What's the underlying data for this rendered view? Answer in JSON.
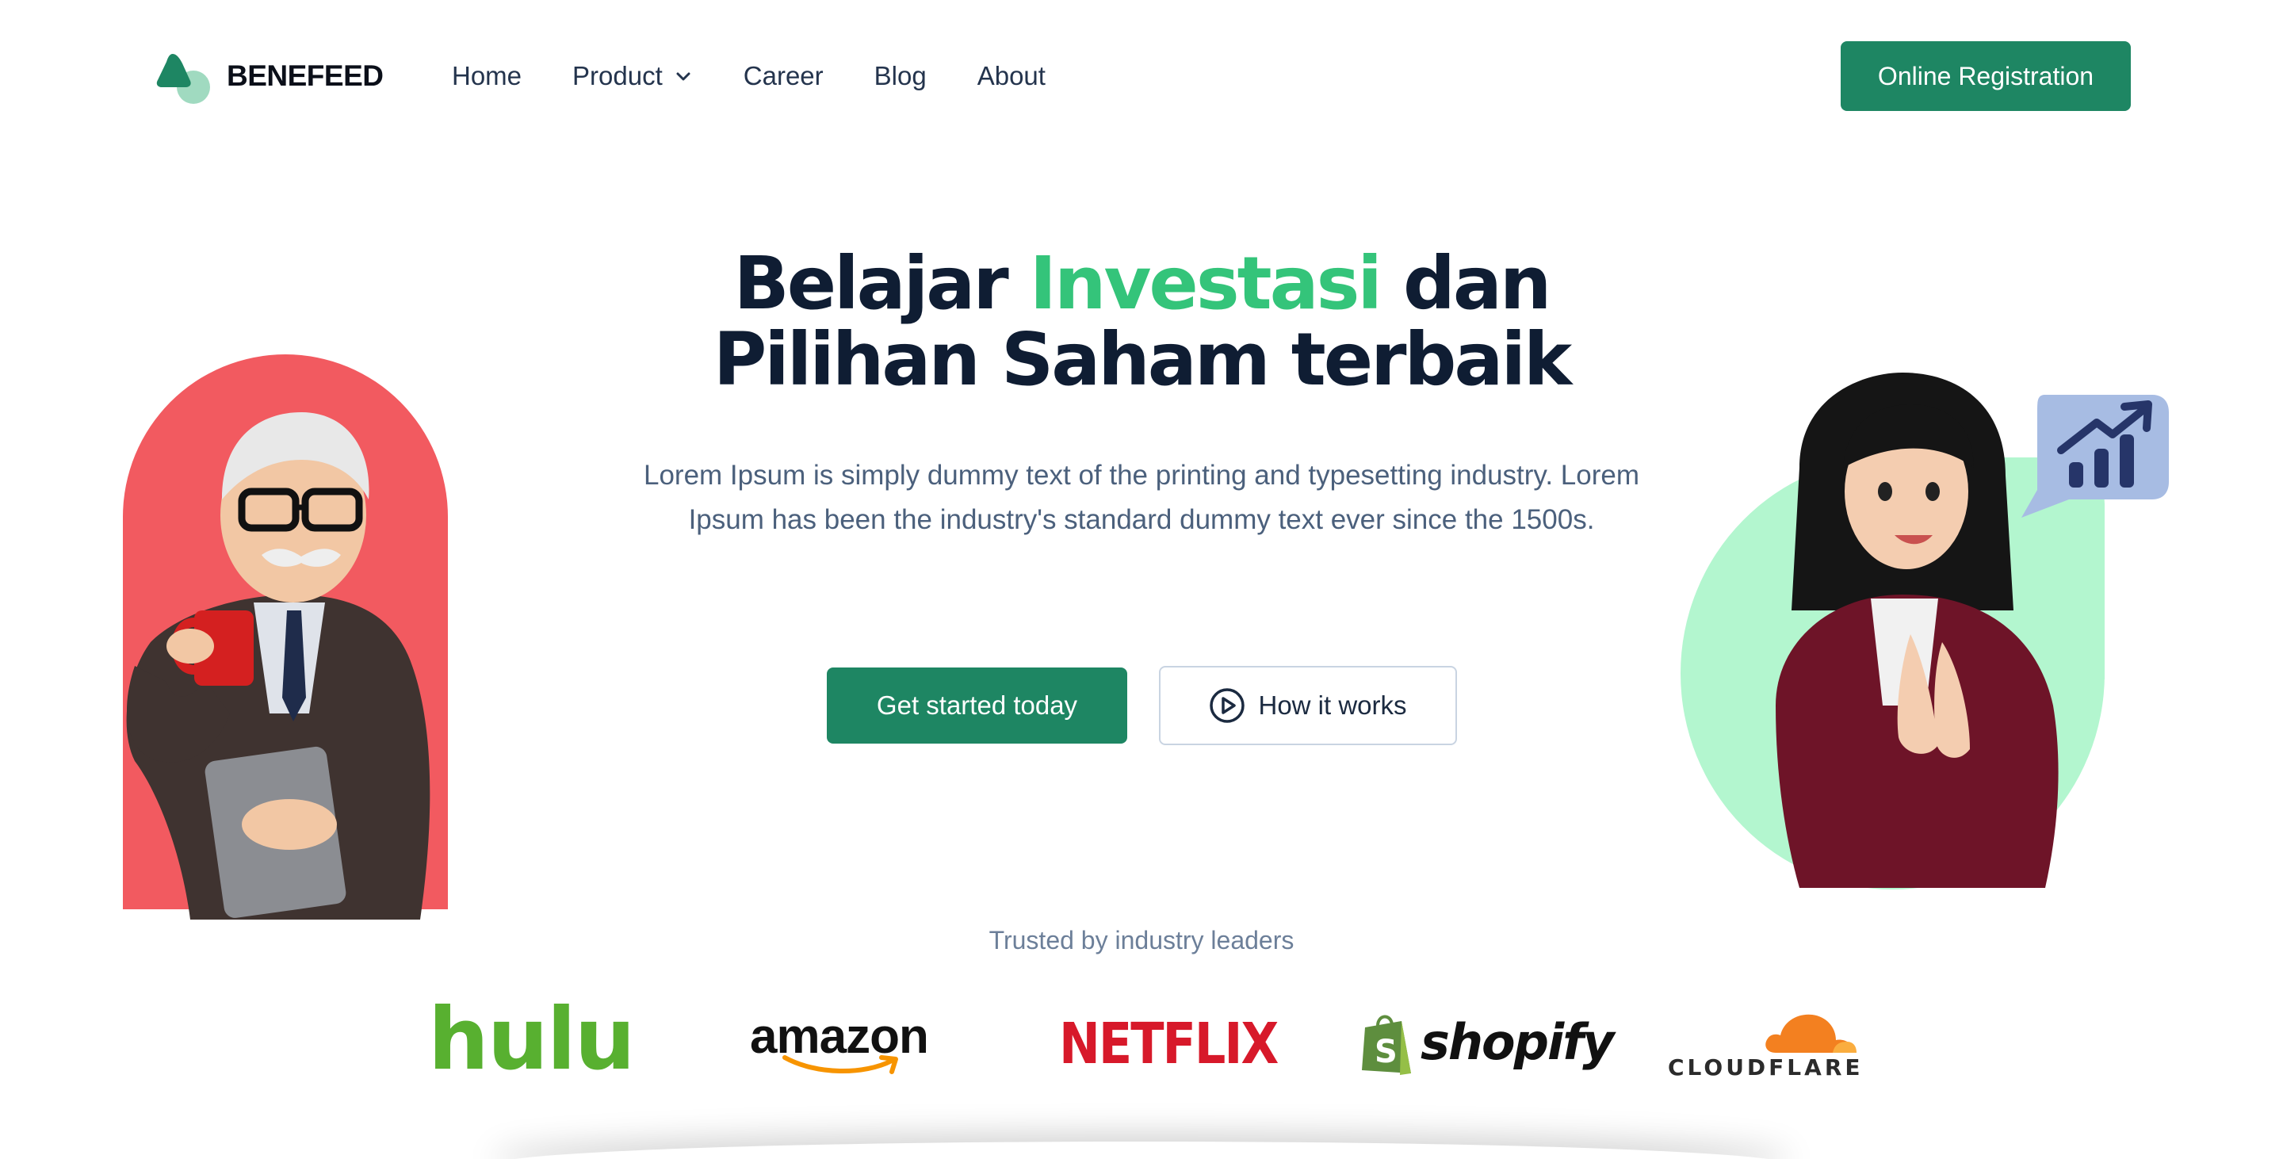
{
  "brand": {
    "name": "BENEFEED",
    "color": "#1e8663"
  },
  "nav": {
    "items": [
      {
        "label": "Home"
      },
      {
        "label": "Product",
        "has_dropdown": true
      },
      {
        "label": "Career"
      },
      {
        "label": "Blog"
      },
      {
        "label": "About"
      }
    ],
    "cta_label": "Online Registration"
  },
  "hero": {
    "title_line1_pre": "Belajar ",
    "title_line1_highlight": "Investasi",
    "title_line1_post": " dan",
    "title_line2": "Pilihan Saham terbaik",
    "description": "Lorem Ipsum is simply dummy text of the printing and typesetting industry. Lorem Ipsum has been the industry's standard dummy text ever since the 1500s.",
    "primary_button": "Get started today",
    "secondary_button": "How it works",
    "highlight_color": "#34c47a"
  },
  "illustrations": {
    "left": {
      "icon": "businessman-with-mug-icon",
      "background": "#f25a60"
    },
    "right": {
      "icon": "businesswoman-greeting-icon",
      "background": "#b3f6cf",
      "badge_icon": "chart-growth-bubble-icon"
    }
  },
  "trusted": {
    "label": "Trusted by industry leaders",
    "logos": [
      {
        "text": "hulu",
        "color": "#58b030"
      },
      {
        "text": "amazon",
        "color": "#111111"
      },
      {
        "text": "NETFLIX",
        "color": "#d7192a"
      },
      {
        "text": "shopify",
        "color": "#111111"
      },
      {
        "text": "CLOUDFLARE",
        "color": "#f38020"
      }
    ]
  }
}
